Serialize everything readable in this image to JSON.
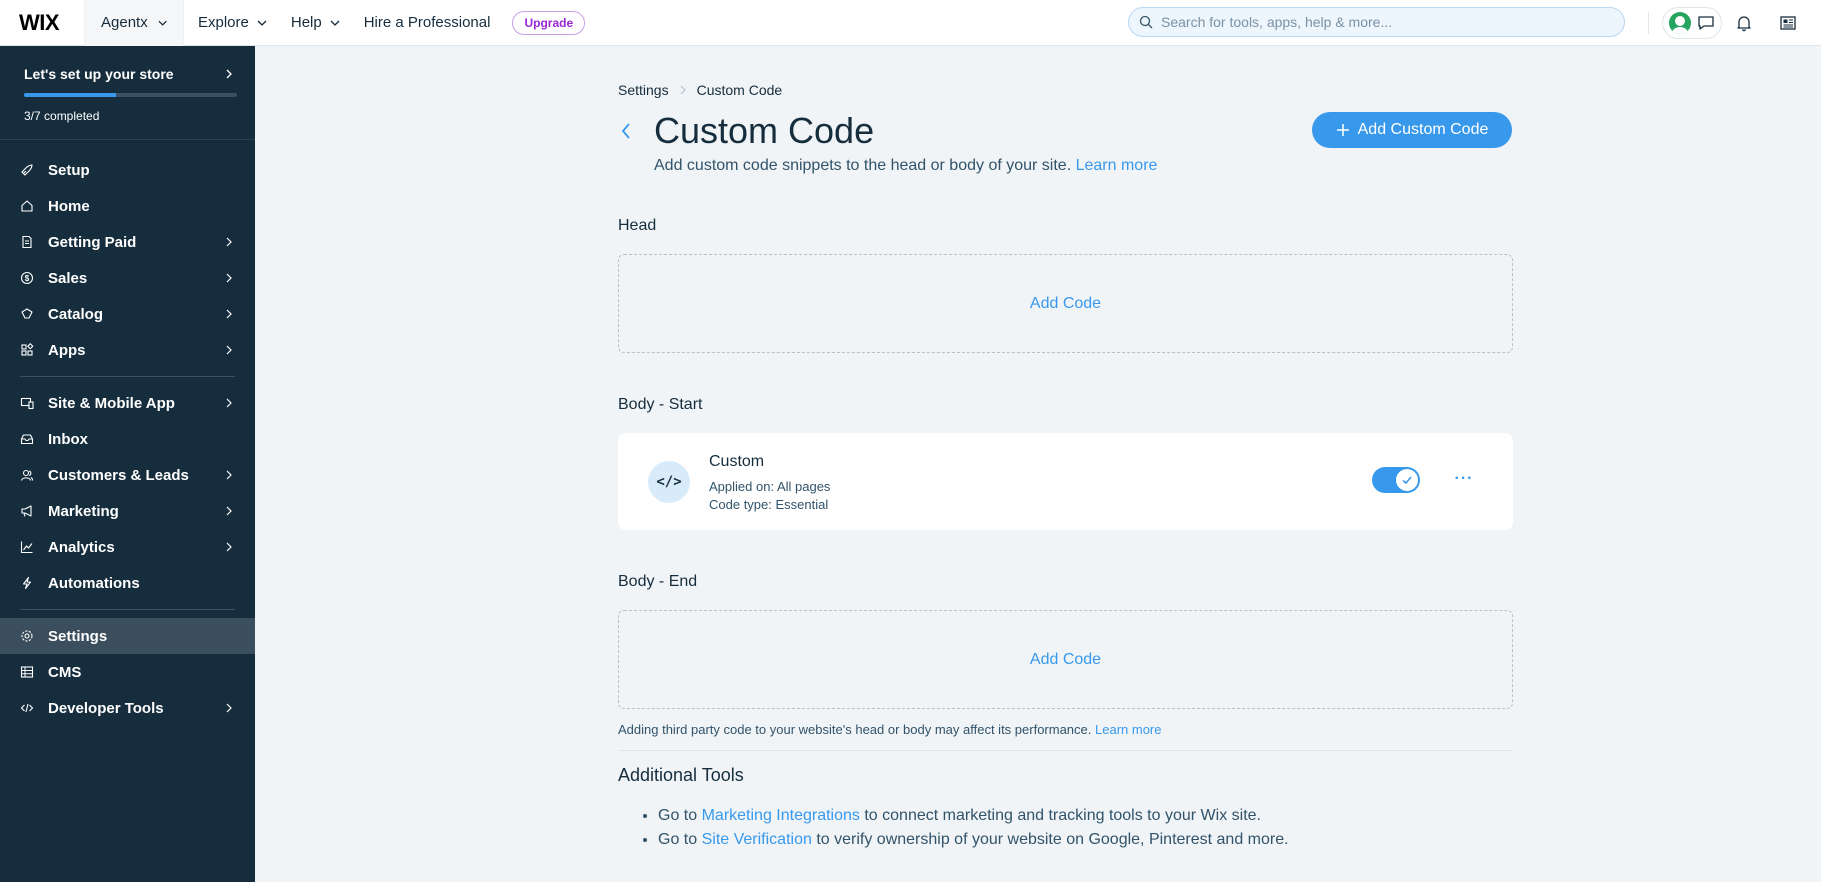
{
  "topbar": {
    "logo": "WIX",
    "site_name": "Agentx",
    "nav": [
      "Explore",
      "Help",
      "Hire a Professional"
    ],
    "upgrade_label": "Upgrade",
    "search_placeholder": "Search for tools, apps, help & more..."
  },
  "sidebar": {
    "setup_title": "Let's set up your store",
    "setup_progress": "3/7 completed",
    "setup_progress_fraction": 0.43,
    "group1": [
      {
        "label": "Setup",
        "icon": "rocket-icon",
        "chevron": false
      },
      {
        "label": "Home",
        "icon": "home-icon",
        "chevron": false
      },
      {
        "label": "Getting Paid",
        "icon": "receipt-icon",
        "chevron": true
      },
      {
        "label": "Sales",
        "icon": "dollar-icon",
        "chevron": true
      },
      {
        "label": "Catalog",
        "icon": "catalog-icon",
        "chevron": true
      },
      {
        "label": "Apps",
        "icon": "apps-icon",
        "chevron": true
      }
    ],
    "group2": [
      {
        "label": "Site & Mobile App",
        "icon": "devices-icon",
        "chevron": true
      },
      {
        "label": "Inbox",
        "icon": "inbox-icon",
        "chevron": false
      },
      {
        "label": "Customers & Leads",
        "icon": "customers-icon",
        "chevron": true
      },
      {
        "label": "Marketing",
        "icon": "megaphone-icon",
        "chevron": true
      },
      {
        "label": "Analytics",
        "icon": "analytics-icon",
        "chevron": true
      },
      {
        "label": "Automations",
        "icon": "bolt-icon",
        "chevron": false
      }
    ],
    "group3": [
      {
        "label": "Settings",
        "icon": "gear-icon",
        "chevron": false,
        "active": true
      },
      {
        "label": "CMS",
        "icon": "table-icon",
        "chevron": false
      },
      {
        "label": "Developer Tools",
        "icon": "code-icon",
        "chevron": true
      }
    ]
  },
  "breadcrumb": {
    "parent": "Settings",
    "current": "Custom Code"
  },
  "page": {
    "title": "Custom Code",
    "subtitle": "Add custom code snippets to the head or body of your site.",
    "subtitle_link": "Learn more",
    "add_button": "Add Custom Code"
  },
  "sections": {
    "head_label": "Head",
    "head_add": "Add Code",
    "body_start_label": "Body - Start",
    "body_end_label": "Body - End",
    "body_end_add": "Add Code"
  },
  "snippet": {
    "icon_glyph": "</>",
    "name": "Custom",
    "applied_on": "Applied on: All pages",
    "code_type": "Code type: Essential",
    "enabled": true
  },
  "footnote": {
    "text": "Adding third party code to your website's head or body may affect its performance.",
    "link": "Learn more"
  },
  "additional": {
    "title": "Additional Tools",
    "items": [
      {
        "prefix": "Go to",
        "link": "Marketing Integrations",
        "suffix": "to connect marketing and tracking tools to your Wix site."
      },
      {
        "prefix": "Go to",
        "link": "Site Verification",
        "suffix": "to verify ownership of your website on Google, Pinterest and more."
      }
    ]
  },
  "colors": {
    "accent": "#3899ec",
    "sidebar_bg": "#162d3d",
    "page_bg": "#f0f4f7",
    "upgrade": "#9a27d5"
  }
}
